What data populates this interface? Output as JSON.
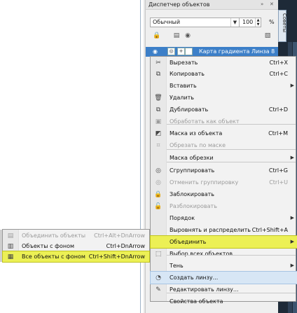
{
  "panel": {
    "title": "Диспетчер объектов",
    "controls": [
      "»",
      "✕"
    ],
    "view_select": "Обычный",
    "zoom": "100",
    "zoom_unit": "%",
    "layer_name": "Карта градиента Линза 8"
  },
  "right_strip": {
    "tab_label": "Советы"
  },
  "context_menu": [
    {
      "icon": "scissors-icon",
      "glyph": "✂",
      "label": "Вырезать",
      "shortcut": "Ctrl+X",
      "enabled": true,
      "submenu": false
    },
    {
      "icon": "copy-icon",
      "glyph": "⧉",
      "label": "Копировать",
      "shortcut": "Ctrl+C",
      "enabled": true,
      "submenu": false
    },
    {
      "icon": "",
      "glyph": "",
      "label": "Вставить",
      "shortcut": "",
      "enabled": true,
      "submenu": true
    },
    {
      "icon": "trash-icon",
      "glyph": "🗑",
      "label": "Удалить",
      "shortcut": "",
      "enabled": true,
      "submenu": false
    },
    {
      "icon": "duplicate-icon",
      "glyph": "⧉",
      "label": "Дублировать",
      "shortcut": "Ctrl+D",
      "enabled": true,
      "submenu": false
    },
    {
      "icon": "process-object-icon",
      "glyph": "▣",
      "label": "Обработать как объект",
      "shortcut": "",
      "enabled": false,
      "submenu": false
    },
    {
      "icon": "mask-from-object-icon",
      "glyph": "◩",
      "label": "Маска из объекта",
      "shortcut": "Ctrl+M",
      "enabled": true,
      "submenu": false
    },
    {
      "icon": "crop-to-mask-icon",
      "glyph": "⌗",
      "label": "Обрезать по маске",
      "shortcut": "",
      "enabled": false,
      "submenu": false
    },
    {
      "icon": "",
      "glyph": "",
      "label": "Маска обрезки",
      "shortcut": "",
      "enabled": true,
      "submenu": true
    },
    {
      "icon": "group-icon",
      "glyph": "◎",
      "label": "Сгруппировать",
      "shortcut": "Ctrl+G",
      "enabled": true,
      "submenu": false
    },
    {
      "icon": "ungroup-icon",
      "glyph": "◎",
      "label": "Отменить группировку",
      "shortcut": "Ctrl+U",
      "enabled": false,
      "submenu": false
    },
    {
      "icon": "lock-icon",
      "glyph": "🔒",
      "label": "Заблокировать",
      "shortcut": "",
      "enabled": true,
      "submenu": false
    },
    {
      "icon": "unlock-icon",
      "glyph": "🔓",
      "label": "Разблокировать",
      "shortcut": "",
      "enabled": false,
      "submenu": false
    },
    {
      "icon": "",
      "glyph": "",
      "label": "Порядок",
      "shortcut": "",
      "enabled": true,
      "submenu": true
    },
    {
      "icon": "",
      "glyph": "",
      "label": "Выровнять и распределить",
      "shortcut": "Ctrl+Shift+A",
      "enabled": true,
      "submenu": false
    },
    {
      "icon": "",
      "glyph": "",
      "label": "Объединить",
      "shortcut": "",
      "enabled": true,
      "submenu": true,
      "highlight": "yellow"
    },
    {
      "icon": "select-all-icon",
      "glyph": "⬚",
      "label": "Выбор всех объектов",
      "shortcut": "",
      "enabled": true,
      "submenu": false
    },
    {
      "icon": "",
      "glyph": "",
      "label": "Тень",
      "shortcut": "",
      "enabled": true,
      "submenu": true
    },
    {
      "icon": "create-lens-icon",
      "glyph": "◔",
      "label": "Создать линзу...",
      "shortcut": "",
      "enabled": true,
      "submenu": false,
      "highlight": "blue"
    },
    {
      "icon": "edit-lens-icon",
      "glyph": "✎",
      "label": "Редактировать линзу...",
      "shortcut": "",
      "enabled": true,
      "submenu": false
    },
    {
      "icon": "",
      "glyph": "",
      "label": "Свойства объекта",
      "shortcut": "",
      "enabled": true,
      "submenu": false
    }
  ],
  "submenu": [
    {
      "icon": "merge-objects-icon",
      "glyph": "▤",
      "label": "Объединить объекты",
      "shortcut": "Ctrl+Alt+DnArrow",
      "enabled": false
    },
    {
      "icon": "merge-with-background-icon",
      "glyph": "▥",
      "label": "Объекты с фоном",
      "shortcut": "Ctrl+DnArrow",
      "enabled": true
    },
    {
      "icon": "merge-all-icon",
      "glyph": "▦",
      "label": "Все объекты с фоном",
      "shortcut": "Ctrl+Shift+DnArrow",
      "enabled": true,
      "highlight": "yellow"
    }
  ],
  "colors": {
    "highlight_yellow": "#ecf055",
    "highlight_blue": "#d7e6f5",
    "layer_row": "#3c7fc8",
    "dark_strip": "#1e2a38"
  }
}
